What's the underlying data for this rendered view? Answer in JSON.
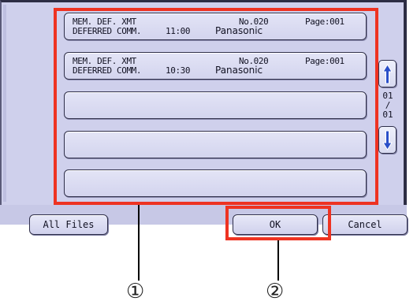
{
  "file_list": {
    "rows": [
      {
        "mode": "MEM. DEF. XMT",
        "type": "DEFERRED COMM.",
        "time": "11:00",
        "number": "No.020",
        "destination": "Panasonic",
        "pages": "Page:001"
      },
      {
        "mode": "MEM. DEF. XMT",
        "type": "DEFERRED COMM.",
        "time": "10:30",
        "number": "No.020",
        "destination": "Panasonic",
        "pages": "Page:001"
      }
    ],
    "empty_rows": 3
  },
  "pager": {
    "current": "01",
    "separator": "/",
    "total": "01"
  },
  "icons": {
    "scroll_up": "arrow-up-icon",
    "scroll_down": "arrow-down-icon"
  },
  "buttons": {
    "all_files": "All Files",
    "ok": "OK",
    "cancel": "Cancel"
  },
  "callouts": {
    "list": "①",
    "ok": "②"
  },
  "colors": {
    "highlight": "#ee3322",
    "panel": "#cfd0ec",
    "arrow_fill": "#2a4fc8"
  }
}
